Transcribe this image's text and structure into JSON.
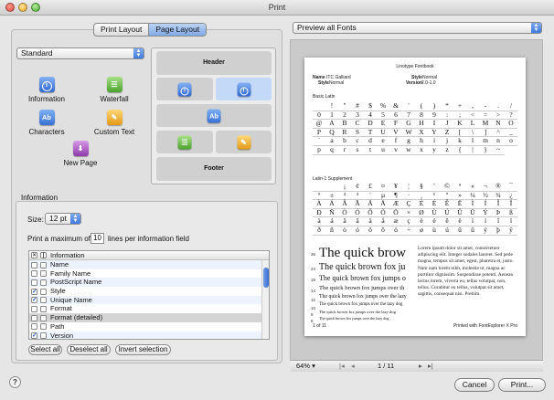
{
  "window": {
    "title": "Print"
  },
  "tabs": [
    {
      "label": "Print Layout",
      "active": false
    },
    {
      "label": "Page Layout",
      "active": true
    }
  ],
  "template_select": {
    "value": "Standard"
  },
  "icon_palette": [
    {
      "label": "Information",
      "icon": "info-icon"
    },
    {
      "label": "Waterfall",
      "icon": "waterfall-icon"
    },
    {
      "label": "Characters",
      "icon": "characters-icon"
    },
    {
      "label": "Custom Text",
      "icon": "custom-text-icon"
    },
    {
      "label": "New Page",
      "icon": "new-page-icon"
    }
  ],
  "layout_preview": {
    "header": "Header",
    "footer": "Footer",
    "ab_glyph": "Ab"
  },
  "information": {
    "title": "Information",
    "size_label": "Size:",
    "size_value": "12 pt",
    "max_prefix": "Print a maximum of",
    "max_value": "10",
    "max_suffix": "lines per information field",
    "list_header": "Information",
    "fields": [
      {
        "label": "Name",
        "checked": false
      },
      {
        "label": "Family Name",
        "checked": false
      },
      {
        "label": "PostScript Name",
        "checked": false
      },
      {
        "label": "Style",
        "checked": true
      },
      {
        "label": "Unique Name",
        "checked": true
      },
      {
        "label": "Format",
        "checked": false
      },
      {
        "label": "Format (detailed)",
        "checked": false
      },
      {
        "label": "Path",
        "checked": false
      },
      {
        "label": "Version",
        "checked": true
      }
    ],
    "buttons": {
      "select_all": "Select all",
      "deselect_all": "Deselect all",
      "invert": "Invert selection"
    }
  },
  "preview": {
    "select_value": "Preview all Fonts",
    "page": {
      "title": "Linotype Fontbook",
      "name_label": "Name",
      "name_value": "ITC Galliard",
      "style_label": "Style",
      "style_value": "Normal",
      "style_label2": "Style",
      "style_value2": "Normal",
      "version_label": "Version",
      "version_value": "2.0-1.0",
      "section1": "Basic Latin",
      "section2": "Latin-1 Supplement",
      "basic_latin": [
        "!",
        "\"",
        "#",
        "$",
        "%",
        "&",
        "'",
        "(",
        ")",
        "*",
        "+",
        ",",
        "-",
        ".",
        "/",
        "0",
        "1",
        "2",
        "3",
        "4",
        "5",
        "6",
        "7",
        "8",
        "9",
        ":",
        ";",
        "<",
        "=",
        ">",
        "?",
        "@",
        "A",
        "B",
        "C",
        "D",
        "E",
        "F",
        "G",
        "H",
        "I",
        "J",
        "K",
        "L",
        "M",
        "N",
        "O",
        "P",
        "Q",
        "R",
        "S",
        "T",
        "U",
        "V",
        "W",
        "X",
        "Y",
        "Z",
        "[",
        "\\",
        "]",
        "^",
        "_",
        "`",
        "a",
        "b",
        "c",
        "d",
        "e",
        "f",
        "g",
        "h",
        "i",
        "j",
        "k",
        "l",
        "m",
        "n",
        "o",
        "p",
        "q",
        "r",
        "s",
        "t",
        "u",
        "v",
        "w",
        "x",
        "y",
        "z",
        "{",
        "|",
        "}",
        "~"
      ],
      "latin1": [
        "¡",
        "¢",
        "£",
        "¤",
        "¥",
        "¦",
        "§",
        "¨",
        "©",
        "ª",
        "«",
        "¬",
        "®",
        "¯",
        "°",
        "±",
        "²",
        "³",
        "´",
        "µ",
        "¶",
        "·",
        "¸",
        "¹",
        "º",
        "»",
        "¼",
        "½",
        "¾",
        "¿",
        "À",
        "Á",
        "Â",
        "Ã",
        "Ä",
        "Å",
        "Æ",
        "Ç",
        "È",
        "É",
        "Ê",
        "Ë",
        "Ì",
        "Í",
        "Î",
        "Ï",
        "Ð",
        "Ñ",
        "Ò",
        "Ó",
        "Ô",
        "Õ",
        "Ö",
        "×",
        "Ø",
        "Ù",
        "Ú",
        "Û",
        "Ü",
        "Ý",
        "Þ",
        "ß",
        "à",
        "á",
        "â",
        "ã",
        "ä",
        "å",
        "æ",
        "ç",
        "è",
        "é",
        "ê",
        "ë",
        "ì",
        "í",
        "î",
        "ï",
        "ð",
        "ñ",
        "ò",
        "ó",
        "ô",
        "õ",
        "ö",
        "÷",
        "ø",
        "ù",
        "ú",
        "û",
        "ü",
        "ý",
        "þ",
        "ÿ"
      ],
      "waterfall": [
        {
          "size": "36",
          "text": "The quick brow"
        },
        {
          "size": "24",
          "text": "The quick brown fox ju"
        },
        {
          "size": "18",
          "text": "The quick brown fox jumps o"
        },
        {
          "size": "14",
          "text": "The quick brown fox jumps over th"
        },
        {
          "size": "12",
          "text": "The quick brown fox jumps over the lazy"
        },
        {
          "size": "10",
          "text": "The quick brown fox jumps over the lazy dog"
        },
        {
          "size": "9",
          "text": "The quick brown fox jumps over the lazy dog"
        },
        {
          "size": "8",
          "text": "The quick brown fox jumps over the lazy dog"
        },
        {
          "size": "7",
          "text": "The quick brown fox jumps over the lazy dog"
        },
        {
          "size": "6",
          "text": "The quick brown fox jumps over the lazy dog"
        }
      ],
      "lorem": "Lorem ipsum dolor sit amet, consectetuer adipiscing elit. Integer sodales laoreet. Sed pede magna, tempus sit amet, egest, pharetra et, justo. Nam nam lorem nibh, molestie ut, magna ac porttitor dignissim. Suspendisse potenti. Aenean lectus lorem, viverra eu, tellus volutpat, non, tellus. Curabitur eu tellus, volutpat sit amet, sagittis, consequat nisi. Pretiim.",
      "page_num": "1 of 11",
      "printed_with": "Printed with FontExplorer X Pro"
    },
    "zoom": "64%",
    "page_indicator": "1 / 11"
  },
  "footer_buttons": {
    "help": "?",
    "cancel": "Cancel",
    "print": "Print..."
  }
}
